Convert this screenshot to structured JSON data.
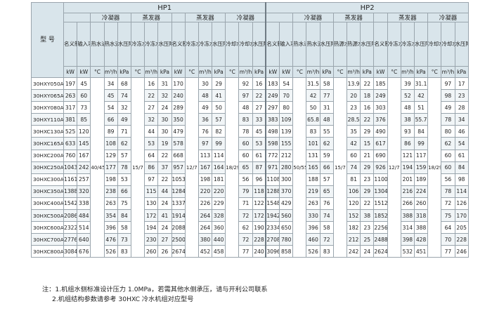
{
  "header": {
    "model": "型\n号",
    "hp1": "HP1",
    "hp2": "HP2",
    "condenser": "冷凝器",
    "evaporator": "蒸发器",
    "hp1_cols": [
      "名义制热量",
      "输入功率",
      "热水进/出水温度",
      "热水流量",
      "水压降",
      "冷冻水进/出水温度",
      "冷冻水流量",
      "水压降",
      "名义制冷量",
      "冷冻水进/出水温度",
      "冷冻水流量",
      "水压降",
      "冷却水进/出水温度",
      "冷却水流量",
      "水压降"
    ],
    "hp2_cols": [
      "名义制热量",
      "输入功率",
      "热水进/出水温度",
      "热水流量",
      "水压降",
      "热源水进/出水温度",
      "热源水流量",
      "水压降",
      "名义制冷量",
      "冷冻水进/出水温度",
      "冷冻水流量",
      "水压降",
      "冷却水进/出水温度",
      "冷却水流量",
      "水压降"
    ],
    "hp1_units": [
      "kW",
      "kW",
      "°C",
      "m³/h",
      "kPa",
      "°C",
      "m³/h",
      "kPa",
      "kW",
      "°C",
      "m³/h",
      "kPa",
      "°C",
      "m³/h",
      "kPa"
    ],
    "hp2_units": [
      "kW",
      "kW",
      "°C",
      "m³/h",
      "kPa",
      "°C",
      "m³/h",
      "kPa",
      "kW",
      "°C",
      "m³/h",
      "kPa",
      "°C",
      "m³/h",
      "kPa"
    ]
  },
  "shared": {
    "hp1_cond_temp": "40/45",
    "hp1_evap_temp": "15/7",
    "hp1_cool_chw_temp": "12/7",
    "hp1_cool_cw_temp": "18/29",
    "hp2_cond_temp": "50/55",
    "hp2_evap_temp": "15/7",
    "hp2_cool_chw_temp": "12/7",
    "hp2_cool_cw_temp": "18/29"
  },
  "rows": [
    {
      "model": "30HXY050A",
      "a": [
        "197",
        "45",
        "34",
        "68",
        "16",
        "31",
        "170",
        "30",
        "29",
        "92",
        "16",
        "17"
      ],
      "b": [
        "183",
        "54",
        "31.5",
        "58",
        "13.9",
        "22",
        "185",
        "39",
        "31.1",
        "97",
        "17",
        "19"
      ]
    },
    {
      "model": "30HXY065A",
      "a": [
        "263",
        "60",
        "45",
        "74",
        "22",
        "32",
        "240",
        "48",
        "41",
        "97",
        "22",
        "23"
      ],
      "b": [
        "249",
        "70",
        "42",
        "77",
        "20",
        "18",
        "249",
        "52",
        "42",
        "98",
        "23",
        "25"
      ]
    },
    {
      "model": "30HXY080A",
      "a": [
        "317",
        "73",
        "54",
        "32",
        "27",
        "24",
        "289",
        "49",
        "50",
        "48",
        "27",
        "28"
      ],
      "b": [
        "297",
        "80",
        "50",
        "31",
        "23",
        "16",
        "303",
        "48",
        "51",
        "49",
        "28",
        "27"
      ]
    },
    {
      "model": "30HXY110A",
      "a": [
        "381",
        "85",
        "66",
        "49",
        "32",
        "30",
        "350",
        "36",
        "57",
        "83",
        "33",
        "48"
      ],
      "b": [
        "383",
        "109",
        "65.8",
        "48",
        "28.5",
        "22",
        "376",
        "38",
        "55.7",
        "78",
        "34",
        "39"
      ]
    },
    {
      "model": "30HXC130A",
      "a": [
        "525",
        "120",
        "89",
        "71",
        "44",
        "30",
        "479",
        "76",
        "82",
        "78",
        "45",
        "15"
      ],
      "b": [
        "498",
        "139",
        "83",
        "55",
        "35",
        "29",
        "490",
        "93",
        "84",
        "80",
        "46",
        "16"
      ]
    },
    {
      "model": "30HXC165A",
      "a": [
        "633",
        "145",
        "108",
        "62",
        "53",
        "19",
        "578",
        "97",
        "99",
        "60",
        "53",
        "23"
      ],
      "b": [
        "598",
        "155",
        "101",
        "62",
        "42",
        "15",
        "617",
        "86",
        "99",
        "62",
        "54",
        "27"
      ]
    },
    {
      "model": "30HXC200A",
      "a": [
        "760",
        "167",
        "129",
        "57",
        "64",
        "22",
        "668",
        "113",
        "114",
        "60",
        "61",
        "11"
      ],
      "b": [
        "772",
        "212",
        "131",
        "59",
        "60",
        "21",
        "690",
        "121",
        "117",
        "60",
        "61",
        "12"
      ]
    },
    {
      "model": "30HXC250A",
      "a": [
        "1043",
        "242",
        "177",
        "78",
        "86",
        "37",
        "957",
        "167",
        "164",
        "65",
        "87",
        "18"
      ],
      "b": [
        "971",
        "280",
        "165",
        "66",
        "74",
        "29",
        "926",
        "194",
        "159",
        "60",
        "84",
        "27"
      ]
    },
    {
      "model": "30HXC300A",
      "a": [
        "1161",
        "257",
        "198",
        "53",
        "97",
        "22",
        "1053",
        "198",
        "181",
        "56",
        "96",
        "25"
      ],
      "b": [
        "1108",
        "300",
        "188",
        "57",
        "81",
        "23",
        "1100",
        "201",
        "189",
        "56",
        "98",
        "26"
      ]
    },
    {
      "model": "30HXC350A",
      "a": [
        "1388",
        "320",
        "238",
        "66",
        "115",
        "44",
        "1284",
        "220",
        "220",
        "79",
        "118",
        "24"
      ],
      "b": [
        "1288",
        "370",
        "219",
        "65",
        "106",
        "29",
        "1304",
        "216",
        "224",
        "78",
        "114",
        "28"
      ]
    },
    {
      "model": "30HXC400A",
      "a": [
        "1542",
        "338",
        "263",
        "75",
        "130",
        "24",
        "1337",
        "226",
        "229",
        "71",
        "122",
        "18"
      ],
      "b": [
        "1548",
        "429",
        "263",
        "76",
        "120",
        "22",
        "1512",
        "266",
        "260",
        "72",
        "126",
        "22"
      ]
    },
    {
      "model": "30HXC500A",
      "a": [
        "2086",
        "484",
        "354",
        "84",
        "172",
        "41",
        "1914",
        "264",
        "328",
        "72",
        "172",
        "18"
      ],
      "b": [
        "1942",
        "560",
        "330",
        "74",
        "152",
        "38",
        "1852",
        "388",
        "318",
        "75",
        "170",
        "21"
      ]
    },
    {
      "model": "30HXC600A",
      "a": [
        "2322",
        "514",
        "396",
        "58",
        "194",
        "24",
        "2088",
        "264",
        "360",
        "62",
        "190",
        "25"
      ],
      "b": [
        "2334",
        "650",
        "396",
        "58",
        "182",
        "23",
        "2256",
        "314",
        "388",
        "64",
        "205",
        "26"
      ]
    },
    {
      "model": "30HXC700A",
      "a": [
        "2776",
        "640",
        "476",
        "73",
        "230",
        "27",
        "2500",
        "380",
        "440",
        "72",
        "228",
        "19"
      ],
      "b": [
        "2708",
        "780",
        "460",
        "72",
        "212",
        "25",
        "2488",
        "398",
        "428",
        "70",
        "228",
        "24"
      ]
    },
    {
      "model": "30HXC800A",
      "a": [
        "3084",
        "676",
        "526",
        "83",
        "260",
        "26",
        "2674",
        "452",
        "458",
        "77",
        "240",
        "27"
      ],
      "b": [
        "3096",
        "858",
        "526",
        "83",
        "242",
        "24",
        "2624",
        "532",
        "451",
        "77",
        "246",
        "20"
      ]
    }
  ],
  "notes": {
    "line1": "注：1.机组水侧标准设计压力 1.0MPa，若需其他水侧承压，请与开利公司联系",
    "line2": "2.机组结构参数请参考 30HXC 冷水机组对应型号"
  }
}
